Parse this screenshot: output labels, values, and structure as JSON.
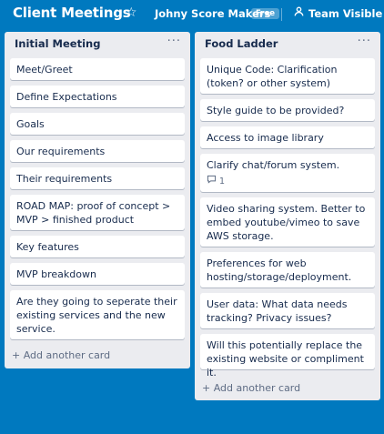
{
  "header": {
    "board_title": "Client Meetings",
    "team_name": "Johny Score Makers",
    "plan_badge": "Free",
    "visibility": "Team Visible"
  },
  "lists": [
    {
      "title": "Initial Meeting",
      "cards": [
        "Meet/Greet",
        "Define Expectations",
        "Goals",
        "Our requirements",
        "Their requirements",
        "ROAD MAP: proof of concept > MVP > finished product",
        "Key features",
        "MVP breakdown",
        "Are they going to seperate their existing services and the new service."
      ],
      "add_label": "+ Add another card"
    },
    {
      "title": "Food Ladder",
      "cards": [
        "Unique Code: Clarification (token? or other system)",
        "Style guide to be provided?",
        "Access to image library",
        "Clarify chat/forum system.",
        "Video sharing system. Better to embed youtube/vimeo to save AWS storage.",
        "Preferences for web hosting/storage/deployment.",
        "User data: What data needs tracking? Privacy issues?",
        "Will this potentially replace the existing website or compliment it."
      ],
      "comment_count": "1",
      "add_label": "+ Add another card"
    }
  ],
  "icons": {
    "star": "star-icon",
    "visibility": "team-visible-icon",
    "menu": "more-icon",
    "comment": "comment-icon"
  },
  "colors": {
    "board_background": "#0079bf",
    "list_background": "#ebecf0",
    "card_background": "#ffffff",
    "text": "#172b4d",
    "muted_text": "#5e6c84"
  }
}
